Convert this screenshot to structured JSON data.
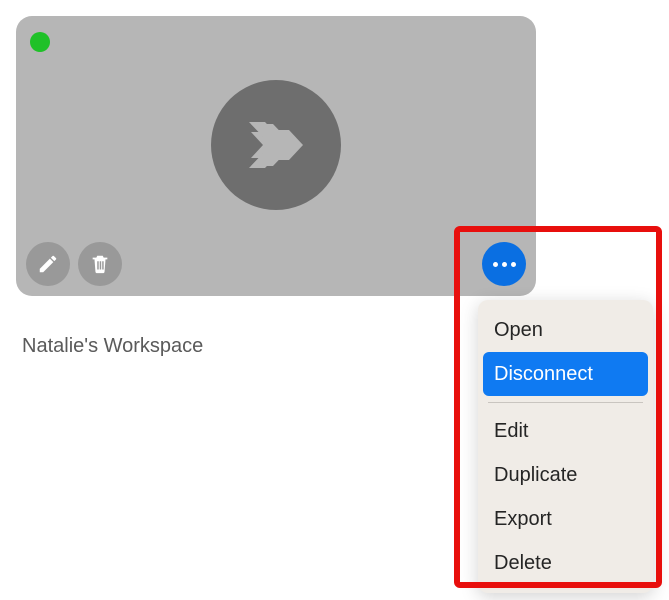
{
  "workspace": {
    "name": "Natalie's Workspace",
    "status_color": "#1fc128"
  },
  "icons": {
    "edit": "pencil-icon",
    "delete": "trash-icon",
    "remote_desktop": "remote-desktop-icon",
    "more": "more-icon"
  },
  "menu": {
    "items": [
      {
        "label": "Open",
        "selected": false
      },
      {
        "label": "Disconnect",
        "selected": true
      }
    ],
    "divider": true,
    "items2": [
      {
        "label": "Edit",
        "selected": false
      },
      {
        "label": "Duplicate",
        "selected": false
      },
      {
        "label": "Export",
        "selected": false
      },
      {
        "label": "Delete",
        "selected": false
      }
    ]
  },
  "colors": {
    "card_bg": "#b6b6b6",
    "accent_blue": "#0a6fe2",
    "highlight_red": "#e80f0d",
    "menu_selected": "#0f7af2"
  }
}
